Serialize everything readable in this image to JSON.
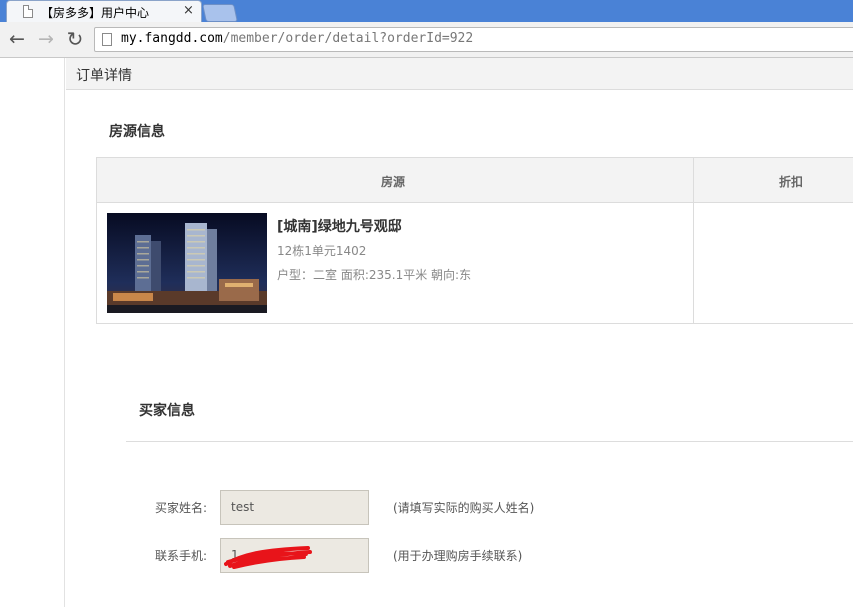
{
  "browser": {
    "tab_title": "【房多多】用户中心",
    "tab_close": "×",
    "url_host": "my.fangdd.com",
    "url_path": "/member/order/detail?orderId=922"
  },
  "page": {
    "header_title": "订单详情",
    "house_section_title": "房源信息",
    "table": {
      "col_house": "房源",
      "col_discount": "折扣"
    },
    "house": {
      "name": "[城南]绿地九号观邸",
      "unit": "12栋1单元1402",
      "attrs": "户型：二室 面积:235.1平米 朝向:东"
    },
    "buyer_section_title": "买家信息",
    "form": {
      "name_label": "买家姓名:",
      "name_value": "test",
      "name_hint": "(请填写实际的购买人姓名)",
      "phone_label": "联系手机:",
      "phone_value": "1",
      "phone_hint": "(用于办理购房手续联系)"
    }
  },
  "colors": {
    "tabstrip": "#4a82d6",
    "header_bg": "#f3f3f3",
    "input_bg": "#ece9e2",
    "redaction": "#e8141a"
  },
  "icons": [
    "page-icon",
    "close-icon",
    "back-arrow-icon",
    "forward-arrow-icon",
    "reload-icon"
  ]
}
